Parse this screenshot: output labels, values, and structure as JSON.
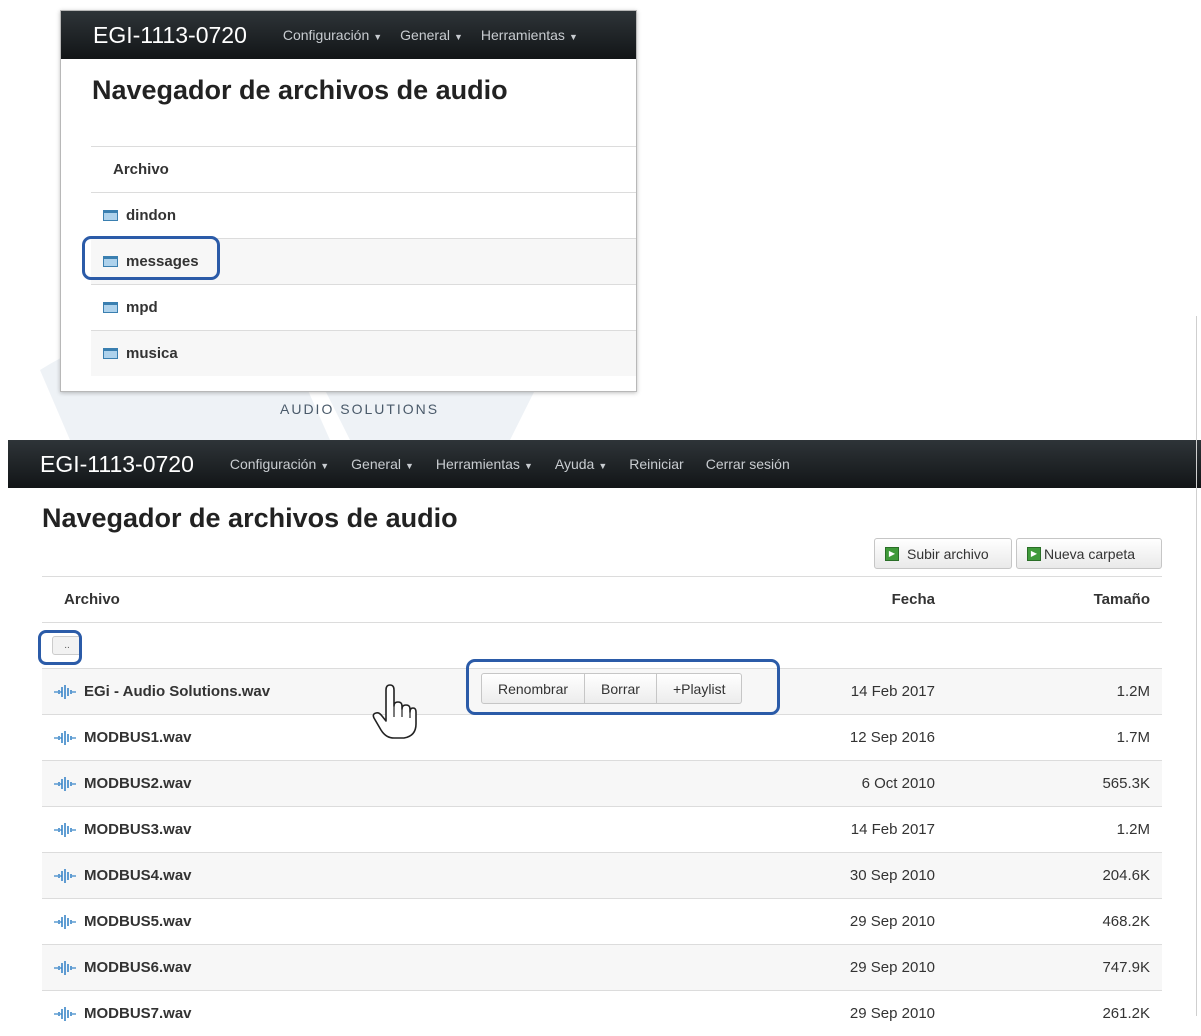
{
  "inset": {
    "brand": "EGI-1113-0720",
    "nav": [
      "Configuración",
      "General",
      "Herramientas"
    ],
    "title": "Navegador de archivos de audio",
    "column_header": "Archivo",
    "folders": [
      "dindon",
      "messages",
      "mpd",
      "musica"
    ]
  },
  "watermark_text": "AUDIO SOLUTIONS",
  "main": {
    "brand": "EGI-1113-0720",
    "nav": [
      "Configuración",
      "General",
      "Herramientas",
      "Ayuda",
      "Reiniciar",
      "Cerrar sesión"
    ],
    "title": "Navegador de archivos de audio",
    "upload_label": "Subir archivo",
    "new_folder_label": "Nueva carpeta",
    "columns": {
      "file": "Archivo",
      "date": "Fecha",
      "size": "Tamaño"
    },
    "parent_label": "..",
    "files": [
      {
        "name": "EGi - Audio Solutions.wav",
        "date": "14 Feb 2017",
        "size": "1.2M"
      },
      {
        "name": "MODBUS1.wav",
        "date": "12 Sep 2016",
        "size": "1.7M"
      },
      {
        "name": "MODBUS2.wav",
        "date": "6 Oct 2010",
        "size": "565.3K"
      },
      {
        "name": "MODBUS3.wav",
        "date": "14 Feb 2017",
        "size": "1.2M"
      },
      {
        "name": "MODBUS4.wav",
        "date": "30 Sep 2010",
        "size": "204.6K"
      },
      {
        "name": "MODBUS5.wav",
        "date": "29 Sep 2010",
        "size": "468.2K"
      },
      {
        "name": "MODBUS6.wav",
        "date": "29 Sep 2010",
        "size": "747.9K"
      },
      {
        "name": "MODBUS7.wav",
        "date": "29 Sep 2010",
        "size": "261.2K"
      }
    ],
    "row_actions": {
      "rename": "Renombrar",
      "delete": "Borrar",
      "playlist": "+Playlist"
    }
  },
  "colors": {
    "navbar": "#1b1f22",
    "highlight": "#2b5ba8",
    "icon_green": "#3f9a3a",
    "folder_blue": "#aed2ec"
  }
}
